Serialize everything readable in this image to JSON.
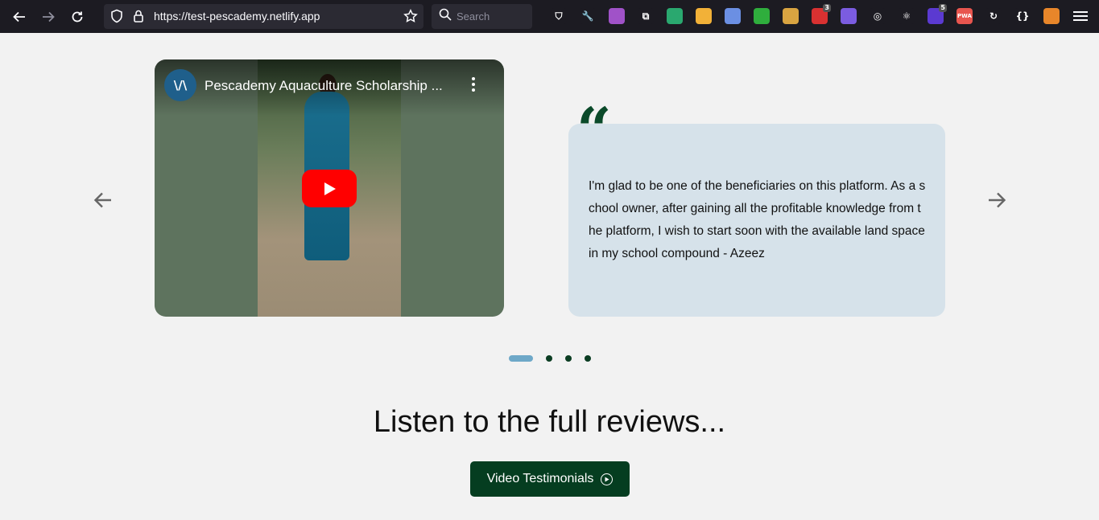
{
  "browser": {
    "url": "https://test-pescademy.netlify.app",
    "search_placeholder": "Search",
    "extensions": [
      {
        "name": "pocket-icon",
        "color": "#1c1b22",
        "glyph": "⛉"
      },
      {
        "name": "wrench-icon",
        "color": "#1c1b22",
        "glyph": "🔧"
      },
      {
        "name": "ghost-extension-icon",
        "color": "#a052c8",
        "glyph": ""
      },
      {
        "name": "puzzle-extension-icon",
        "color": "#1c1b22",
        "glyph": "⧉"
      },
      {
        "name": "eye-dropper-extension-icon",
        "color": "#2aa86f",
        "glyph": ""
      },
      {
        "name": "colorful-extension-icon",
        "color": "#f2b138",
        "glyph": ""
      },
      {
        "name": "translate-extension-icon",
        "color": "#6b8fe3",
        "glyph": ""
      },
      {
        "name": "ruler-extension-icon",
        "color": "#2fae3d",
        "glyph": ""
      },
      {
        "name": "brush-extension-icon",
        "color": "#d9a441",
        "glyph": ""
      },
      {
        "name": "shield-extension-icon",
        "color": "#d93131",
        "glyph": "",
        "badge": "3"
      },
      {
        "name": "gear-extension-icon",
        "color": "#7b5ce0",
        "glyph": ""
      },
      {
        "name": "cookie-extension-icon",
        "color": "#1c1b22",
        "glyph": "◎"
      },
      {
        "name": "react-extension-icon",
        "color": "#1c1b22",
        "glyph": "⚛"
      },
      {
        "name": "stack-extension-icon",
        "color": "#5b3ad1",
        "glyph": "",
        "badge": "5"
      },
      {
        "name": "pwa-extension-icon",
        "color": "#e8554e",
        "glyph": "PWA"
      },
      {
        "name": "refresh-extension-icon",
        "color": "#1c1b22",
        "glyph": "↻"
      },
      {
        "name": "json-extension-icon",
        "color": "#1c1b22",
        "glyph": "{}"
      },
      {
        "name": "fox-extension-icon",
        "color": "#e8862a",
        "glyph": ""
      }
    ]
  },
  "video": {
    "title": "Pescademy Aquaculture Scholarship ...",
    "channel_initials": "\\/\\"
  },
  "testimonial": {
    "text": "I'm glad to be one of the beneficiaries on this platform. As a school owner, after gaining all the profitable knowledge from the platform, I wish to start soon with the available land space in my school compound - Azeez"
  },
  "carousel": {
    "slide_count": 4,
    "active_slide": 1
  },
  "section": {
    "heading": "Listen to the full reviews...",
    "cta_label": "Video Testimonials"
  },
  "colors": {
    "brand_green": "#053d20",
    "dot_active": "#6ea8c8",
    "testimonial_bg": "#d6e2ea"
  }
}
